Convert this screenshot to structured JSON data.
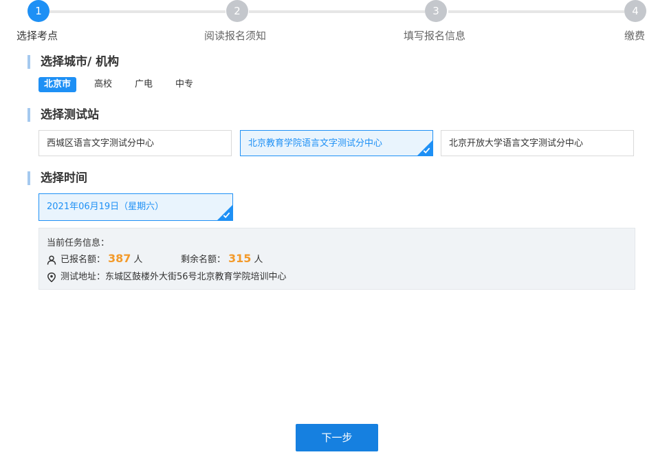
{
  "steps": [
    {
      "number": "1",
      "label": "选择考点"
    },
    {
      "number": "2",
      "label": "阅读报名须知"
    },
    {
      "number": "3",
      "label": "填写报名信息"
    },
    {
      "number": "4",
      "label": "缴费"
    }
  ],
  "sections": {
    "city_title": "选择城市/ 机构",
    "station_title": "选择测试站",
    "time_title": "选择时间"
  },
  "city_tabs": [
    "北京市",
    "高校",
    "广电",
    "中专"
  ],
  "stations": [
    "西城区语言文字测试分中心",
    "北京教育学院语言文字测试分中心",
    "北京开放大学语言文字测试分中心"
  ],
  "time_slot": "2021年06月19日（星期六）",
  "info": {
    "title": "当前任务信息：",
    "registered_label": "已报名额：",
    "registered_count": "387",
    "registered_unit": "人",
    "remaining_label": "剩余名额：",
    "remaining_count": "315",
    "remaining_unit": "人",
    "address": "测试地址：东城区鼓楼外大街56号北京教育学院培训中心"
  },
  "next_button": "下一步",
  "colors": {
    "accent": "#1e90f5",
    "count_highlight": "#f39a2a",
    "step_inactive": "#c4c7cc"
  }
}
